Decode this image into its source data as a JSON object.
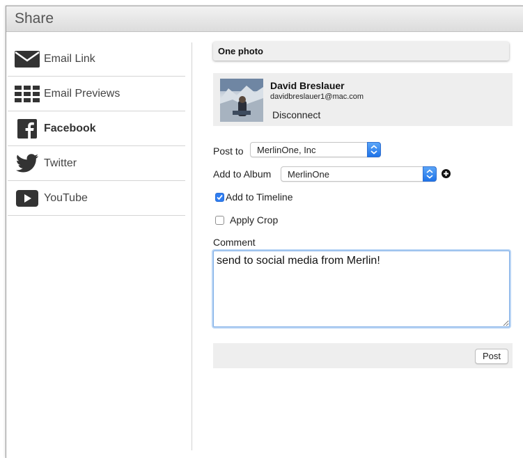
{
  "window": {
    "title": "Share"
  },
  "sidebar": {
    "items": [
      {
        "label": "Email Link",
        "icon": "envelope-icon",
        "active": false
      },
      {
        "label": "Email Previews",
        "icon": "grid-icon",
        "active": false
      },
      {
        "label": "Facebook",
        "icon": "facebook-icon",
        "active": true
      },
      {
        "label": "Twitter",
        "icon": "twitter-bird-icon",
        "active": false
      },
      {
        "label": "YouTube",
        "icon": "youtube-play-icon",
        "active": false
      }
    ]
  },
  "main": {
    "header": "One photo",
    "account": {
      "name": "David Breslauer",
      "email": "davidbreslauer1@mac.com",
      "disconnect_label": "Disconnect"
    },
    "post_to": {
      "label": "Post to",
      "selected": "MerlinOne, Inc"
    },
    "album": {
      "label": "Add to Album",
      "selected": "MerlinOne"
    },
    "add_timeline": {
      "label": "Add to Timeline",
      "checked": true
    },
    "apply_crop": {
      "label": "Apply Crop",
      "checked": false
    },
    "comment": {
      "label": "Comment",
      "value": "send to social media from Merlin!"
    },
    "post_button": "Post"
  },
  "colors": {
    "accent": "#2f7df1",
    "focus_ring": "#b9d5f5",
    "panel_bg": "#eeeeee",
    "icon": "#333333"
  }
}
